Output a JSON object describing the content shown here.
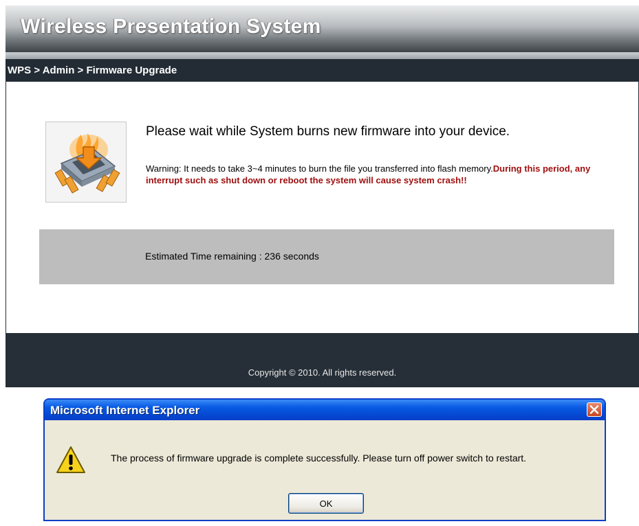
{
  "header": {
    "title": "Wireless Presentation System"
  },
  "breadcrumb": "WPS > Admin > Firmware Upgrade",
  "main": {
    "wait_title": "Please wait while System burns new firmware into your device.",
    "warning_text": "Warning: It needs to take 3~4 minutes to burn the file you transferred into flash memory.",
    "warning_bold": "During this period, any interrupt such as shut down or reboot the system will cause system crash!!",
    "time_remaining": "Estimated Time remaining : 236 seconds",
    "icon": "firmware-chip-icon"
  },
  "footer": {
    "copyright": "Copyright © 2010. All rights reserved."
  },
  "dialog": {
    "title": "Microsoft Internet Explorer",
    "message": "The process of firmware upgrade is complete successfully. Please turn off power switch to restart.",
    "ok_label": "OK",
    "icon": "warning-icon",
    "close_icon": "close-icon"
  },
  "colors": {
    "breadcrumb_bar": "#232c34",
    "warning_red": "#a01010",
    "time_panel": "#bdbdbd",
    "dialog_titlebar": "#0a5ce4"
  }
}
